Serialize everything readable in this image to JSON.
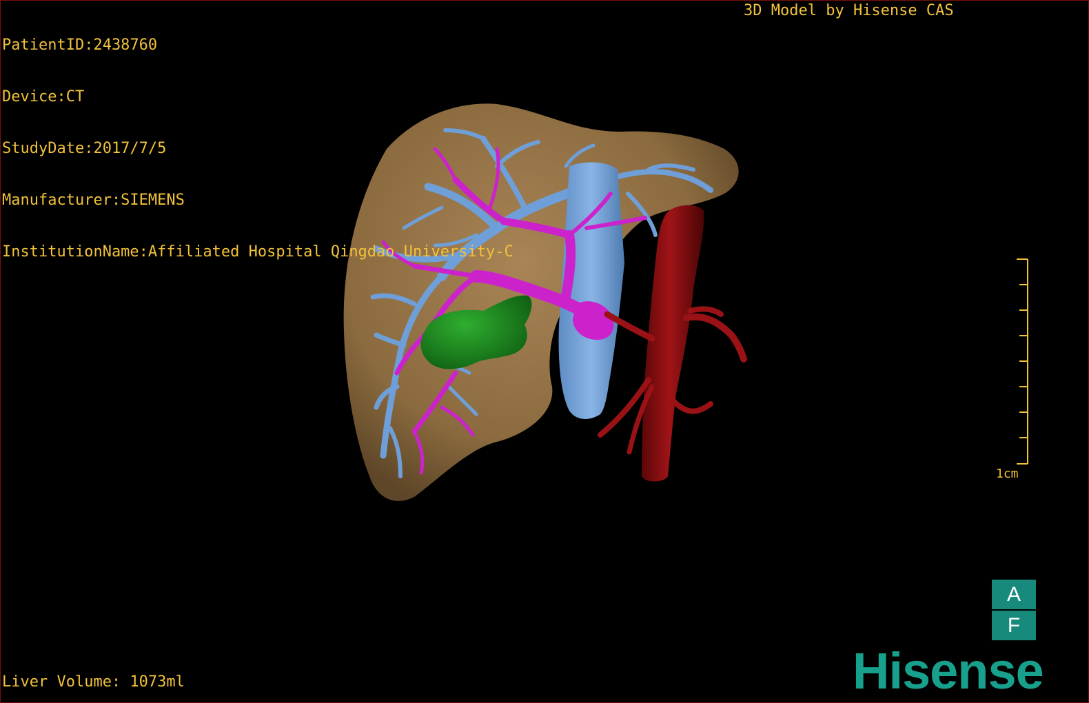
{
  "study_info": [
    "PatientID:2438760",
    "Device:CT",
    "StudyDate:2017/7/5",
    "Manufacturer:SIEMENS",
    "InstitutionName:Affiliated Hospital Qingdao University-C"
  ],
  "credit": "3D Model by Hisense CAS",
  "liver_volume": "Liver Volume: 1073ml",
  "scale_label": "1cm",
  "orientation": {
    "top": "A",
    "bottom": "F"
  },
  "brand": "Hisense",
  "colors": {
    "text": "#f2c23a",
    "liver": "#8a6a3e",
    "hepatic_vein": "#6f9fd8",
    "portal_vein": "#cc22cc",
    "tumor": "#1d8a1d",
    "aorta": "#8a0f12",
    "brand": "#17a08c"
  }
}
